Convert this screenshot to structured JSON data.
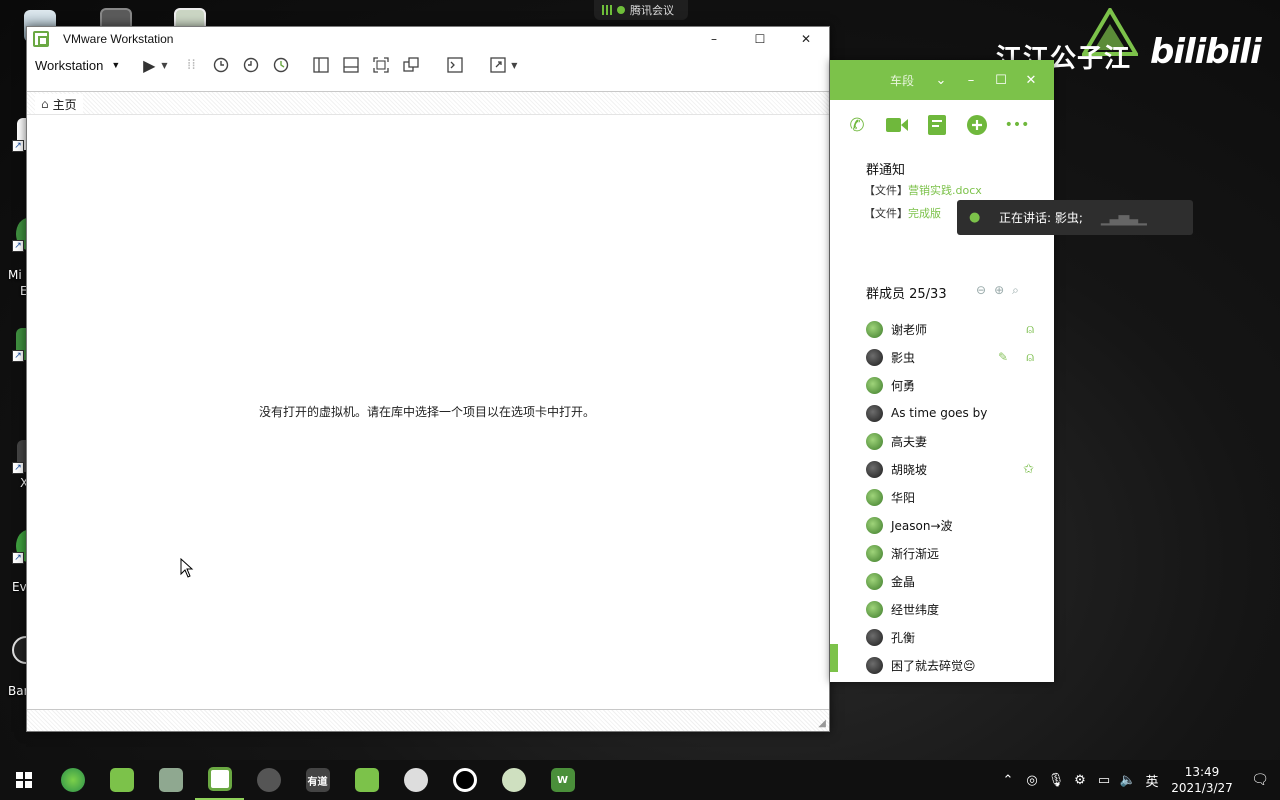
{
  "colors": {
    "accent_green": "#7cc24a",
    "vmware_green": "#6aa842",
    "taskbar": "#101010"
  },
  "meeting_indicator": {
    "label": "腾讯会议"
  },
  "watermark": {
    "channel": "江江公子江",
    "brand": "bilibili"
  },
  "desktop": {
    "labels": [
      "Mi",
      "E",
      "X",
      "Ev",
      "Bar"
    ]
  },
  "vmware": {
    "title": "VMware Workstation",
    "menu_label": "Workstation",
    "home_tab": "主页",
    "empty_message": "没有打开的虚拟机。请在库中选择一个项目以在选项卡中打开。",
    "window_controls": {
      "minimize": "–",
      "maximize": "☐",
      "close": "✕"
    }
  },
  "chat": {
    "title_blurred": "车段",
    "group_notice_title": "群通知",
    "files": [
      {
        "prefix": "【文件】",
        "name": "营销实践.docx"
      },
      {
        "prefix": "【文件】",
        "name": "完成版 "
      }
    ],
    "speaking": {
      "label": "正在讲话: 影虫;"
    },
    "members_header": "群成员 25/33",
    "members": [
      {
        "name": "谢老师",
        "role_icon": "admin-icon",
        "dark": false
      },
      {
        "name": "影虫",
        "role_icon": "admin-icon",
        "edit": true,
        "dark": true
      },
      {
        "name": "何勇",
        "dark": false
      },
      {
        "name": "As time goes by",
        "dark": true
      },
      {
        "name": "高夫妻",
        "dark": false
      },
      {
        "name": "胡晓坡",
        "role_icon": "star-icon",
        "dark": true
      },
      {
        "name": "华阳",
        "dark": false
      },
      {
        "name": "Jeason→波",
        "dark": false
      },
      {
        "name": "渐行渐远",
        "dark": false
      },
      {
        "name": "金晶",
        "dark": false
      },
      {
        "name": "经世纬度",
        "dark": false
      },
      {
        "name": "孔衡",
        "dark": true
      },
      {
        "name": "困了就去碎觉😔",
        "dark": true
      }
    ]
  },
  "taskbar": {
    "apps": [
      "edge",
      "files",
      "pdf",
      "vmware",
      "snail",
      "notes",
      "app",
      "face",
      "obs",
      "paint",
      "word"
    ],
    "app_glyph_labels": {
      "notes": "有道",
      "word": "W"
    },
    "tray_ime": "英",
    "time": "13:49",
    "date": "2021/3/27"
  }
}
